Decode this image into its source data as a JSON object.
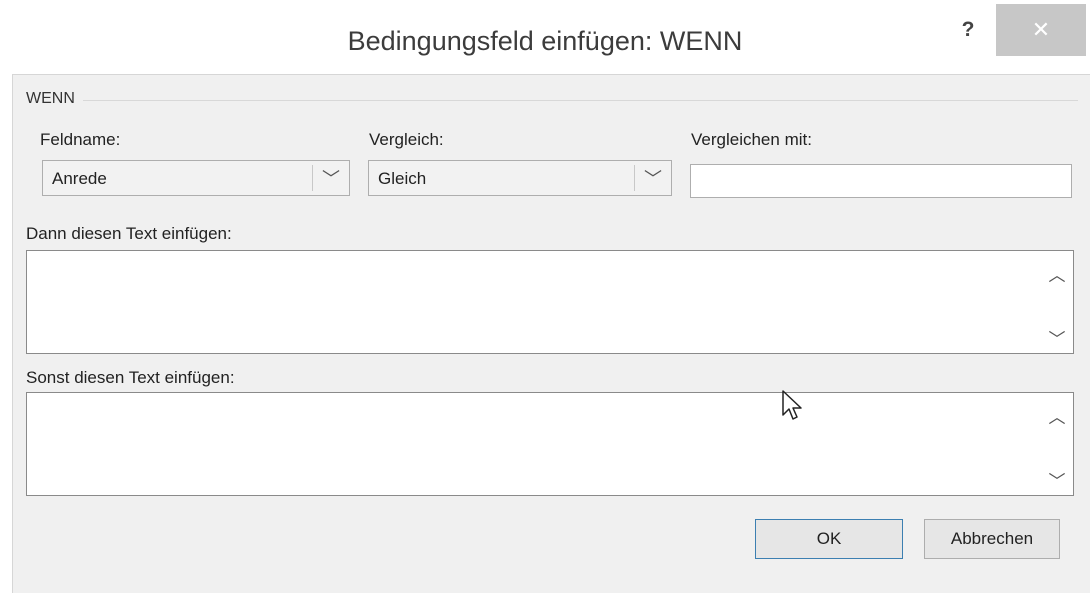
{
  "window": {
    "title": "Bedingungsfeld einfügen: WENN",
    "help_label": "?",
    "close_label": "✕"
  },
  "group": {
    "label": "WENN"
  },
  "fields": {
    "feldname": {
      "label": "Feldname:",
      "value": "Anrede"
    },
    "vergleich": {
      "label": "Vergleich:",
      "value": "Gleich"
    },
    "vergleichen_mit": {
      "label": "Vergleichen mit:",
      "value": ""
    }
  },
  "dann_text": {
    "label": "Dann diesen Text einfügen:",
    "value": ""
  },
  "sonst_text": {
    "label": "Sonst diesen Text einfügen:",
    "value": ""
  },
  "buttons": {
    "ok": "OK",
    "cancel": "Abbrechen"
  },
  "icons": {
    "dropdown": "chevron-down-icon",
    "scroll_up": "scroll-up-arrow-icon",
    "scroll_down": "scroll-down-arrow-icon",
    "cursor": "mouse-pointer-icon"
  }
}
